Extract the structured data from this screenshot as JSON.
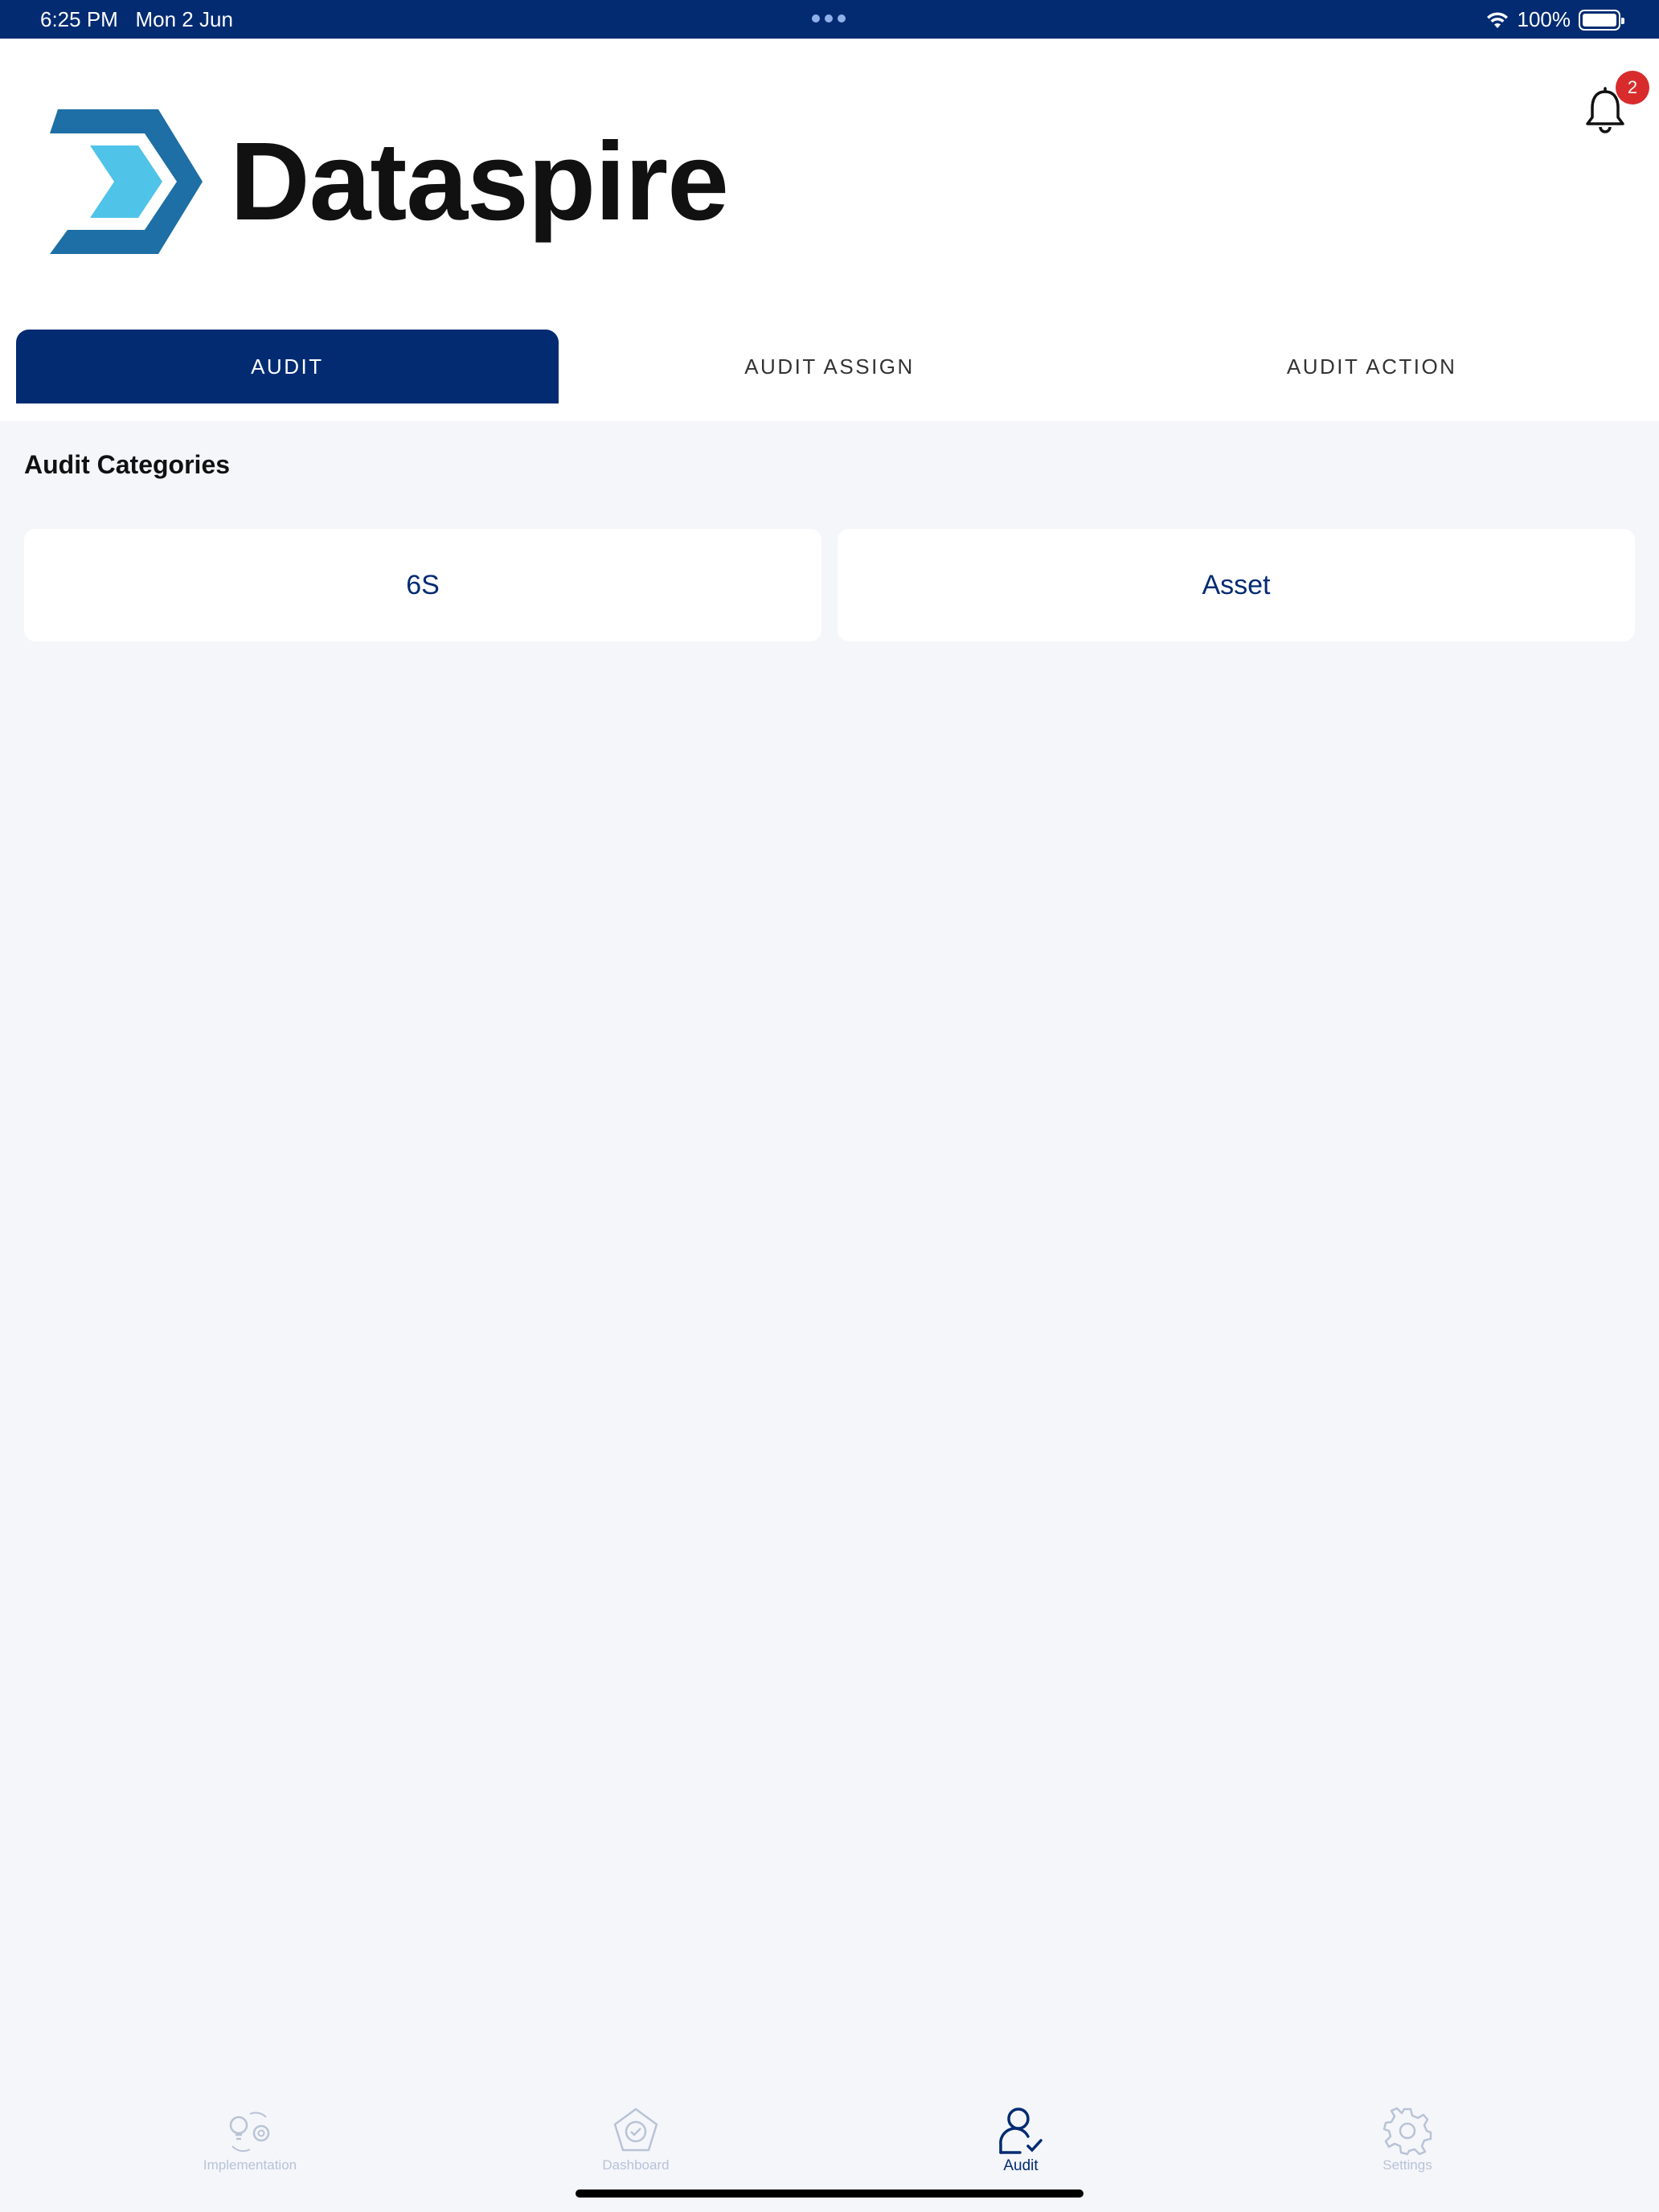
{
  "status_bar": {
    "time": "6:25 PM",
    "date": "Mon 2 Jun",
    "battery": "100%",
    "icons": [
      "wifi-icon",
      "battery-icon"
    ]
  },
  "header": {
    "logo_text": "Dataspire",
    "notification_count": "2",
    "icons": [
      "bell-icon"
    ]
  },
  "tabs": [
    {
      "label": "AUDIT",
      "active": true
    },
    {
      "label": "AUDIT ASSIGN",
      "active": false
    },
    {
      "label": "AUDIT ACTION",
      "active": false
    }
  ],
  "main": {
    "section_title": "Audit Categories",
    "categories": [
      {
        "label": "6S"
      },
      {
        "label": "Asset"
      }
    ]
  },
  "tab_bar": {
    "items": [
      {
        "label": "Implementation",
        "icon": "implementation-icon",
        "active": false
      },
      {
        "label": "Dashboard",
        "icon": "dashboard-icon",
        "active": false
      },
      {
        "label": "Audit",
        "icon": "audit-user-check-icon",
        "active": true
      },
      {
        "label": "Settings",
        "icon": "settings-gear-icon",
        "active": false
      }
    ]
  },
  "colors": {
    "primary": "#022b72",
    "background": "#f5f6fa",
    "badge": "#d82c2c",
    "logo_dark_blue": "#1d6fa5",
    "logo_light_blue": "#4fc3e8",
    "inactive_tab_icon": "#b8c3d6"
  }
}
